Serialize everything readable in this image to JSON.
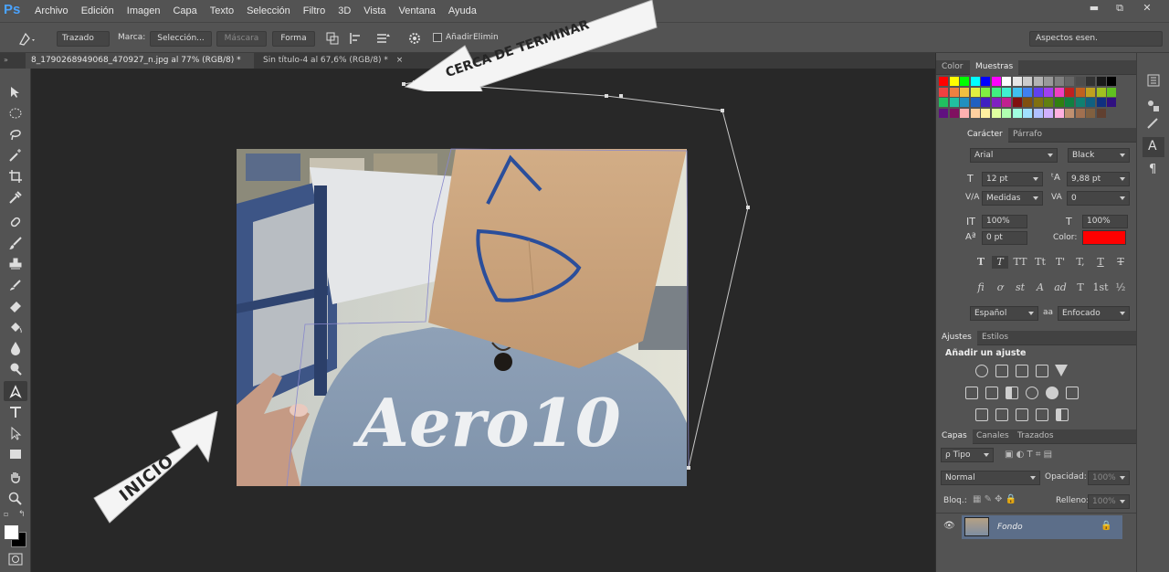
{
  "app": {
    "logo": "Ps"
  },
  "menu": [
    "Archivo",
    "Edición",
    "Imagen",
    "Capa",
    "Texto",
    "Selección",
    "Filtro",
    "3D",
    "Vista",
    "Ventana",
    "Ayuda"
  ],
  "window_buttons": [
    "▬",
    "⧉",
    "✕"
  ],
  "options": {
    "mode": "Trazado",
    "marca_label": "Marca:",
    "seleccion": "Selección...",
    "mascara": "Máscara",
    "forma": "Forma",
    "add_label": "Añadir",
    "elim_label": "Elimin",
    "workspace": "Aspectos esen."
  },
  "tabs": [
    {
      "label": "8_1790268949068_470927_n.jpg al 77% (RGB/8) *",
      "close": "×"
    },
    {
      "label": "Sin título-4 al 67,6% (RGB/8) *",
      "close": "×"
    }
  ],
  "annotations": {
    "start": "INICIO",
    "end": "CERCA DE TERMINAR"
  },
  "photo": {
    "shirt_text": "Aero10"
  },
  "color_panel": {
    "tabs": [
      "Color",
      "Muestras"
    ]
  },
  "swatch_colors": [
    "#ff0000",
    "#ffff00",
    "#00ff00",
    "#00ffff",
    "#0000ff",
    "#ff00ff",
    "#ffffff",
    "#e6e6e6",
    "#cccccc",
    "#b3b3b3",
    "#999999",
    "#808080",
    "#666666",
    "#4d4d4d",
    "#333333",
    "#1a1a1a",
    "#000000",
    "#f04040",
    "#f08040",
    "#f0c040",
    "#e0f040",
    "#80f040",
    "#40f080",
    "#40f0d0",
    "#40c0f0",
    "#4080f0",
    "#6040f0",
    "#a040f0",
    "#f040c0",
    "#c02020",
    "#c06020",
    "#c0a020",
    "#a0c020",
    "#60c020",
    "#20c060",
    "#20c0a0",
    "#2090c0",
    "#2060c0",
    "#4020c0",
    "#8020c0",
    "#c02090",
    "#801010",
    "#805010",
    "#807010",
    "#608010",
    "#308010",
    "#108040",
    "#108070",
    "#106080",
    "#103080",
    "#301080",
    "#601080",
    "#801060",
    "#ffb0b0",
    "#ffd0a0",
    "#fff0a0",
    "#e0ffa0",
    "#b0ffb0",
    "#a0ffe0",
    "#a0e0ff",
    "#b0c0ff",
    "#d0b0ff",
    "#ffb0e0",
    "#c09070",
    "#a07050",
    "#806040",
    "#604030"
  ],
  "character": {
    "tabs": [
      "Carácter",
      "Párrafo"
    ],
    "font_family": "Arial",
    "font_style": "Black",
    "size": "12 pt",
    "leading": "9,88 pt",
    "kerning": "Medidas",
    "tracking": "0",
    "vscale": "100%",
    "hscale": "100%",
    "baseline": "0 pt",
    "color_label": "Color:",
    "color_value": "#ff0000",
    "language": "Español",
    "aa_icon": "aa",
    "antialias": "Enfocado",
    "style_glyphs": [
      "T",
      "T",
      "TT",
      "Tt",
      "T'",
      "T,",
      "T",
      "T"
    ],
    "ot_glyphs": [
      "fi",
      "ơ",
      "st",
      "A",
      "ad",
      "T",
      "1st",
      "½"
    ]
  },
  "adjustments": {
    "tabs": [
      "Ajustes",
      "Estilos"
    ],
    "title": "Añadir un ajuste"
  },
  "layers": {
    "tabs": [
      "Capas",
      "Canales",
      "Trazados"
    ],
    "filter": "ρ Tipo",
    "blend": "Normal",
    "opacity_label": "Opacidad:",
    "opacity": "100%",
    "lock_label": "Bloq.:",
    "fill_label": "Relleno:",
    "fill": "100%",
    "layer_name": "Fondo"
  }
}
